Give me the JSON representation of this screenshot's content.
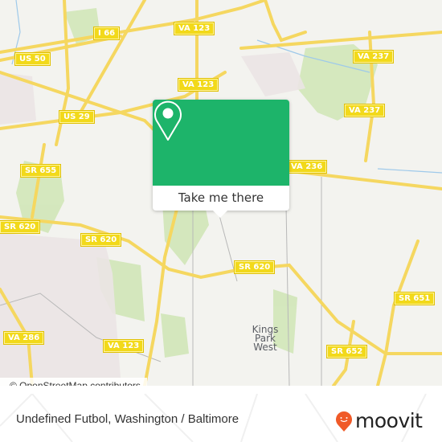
{
  "map": {
    "shields": [
      {
        "id": "i66",
        "label": "I 66"
      },
      {
        "id": "va123-top",
        "label": "VA 123"
      },
      {
        "id": "us50",
        "label": "US 50"
      },
      {
        "id": "va123-mid",
        "label": "VA 123"
      },
      {
        "id": "us29",
        "label": "US 29"
      },
      {
        "id": "va237-top",
        "label": "VA 237"
      },
      {
        "id": "va237-mid",
        "label": "VA 237"
      },
      {
        "id": "sr655",
        "label": "SR 655"
      },
      {
        "id": "va236",
        "label": "VA 236"
      },
      {
        "id": "sr620-left",
        "label": "SR 620"
      },
      {
        "id": "sr620-mid",
        "label": "SR 620"
      },
      {
        "id": "sr620-right",
        "label": "SR 620"
      },
      {
        "id": "sr651",
        "label": "SR 651"
      },
      {
        "id": "va286",
        "label": "VA 286"
      },
      {
        "id": "va123-bottom",
        "label": "VA 123"
      },
      {
        "id": "sr652",
        "label": "SR 652"
      }
    ],
    "place_label": "Kings Park West",
    "attribution": "© OpenStreetMap contributors"
  },
  "popup": {
    "icon": "location-pin-icon",
    "button_label": "Take me there",
    "color": "#1db46a"
  },
  "footer": {
    "title": "Undefined Futbol, Washington / Baltimore",
    "brand": "moovit",
    "brand_color": "#f05a28"
  }
}
